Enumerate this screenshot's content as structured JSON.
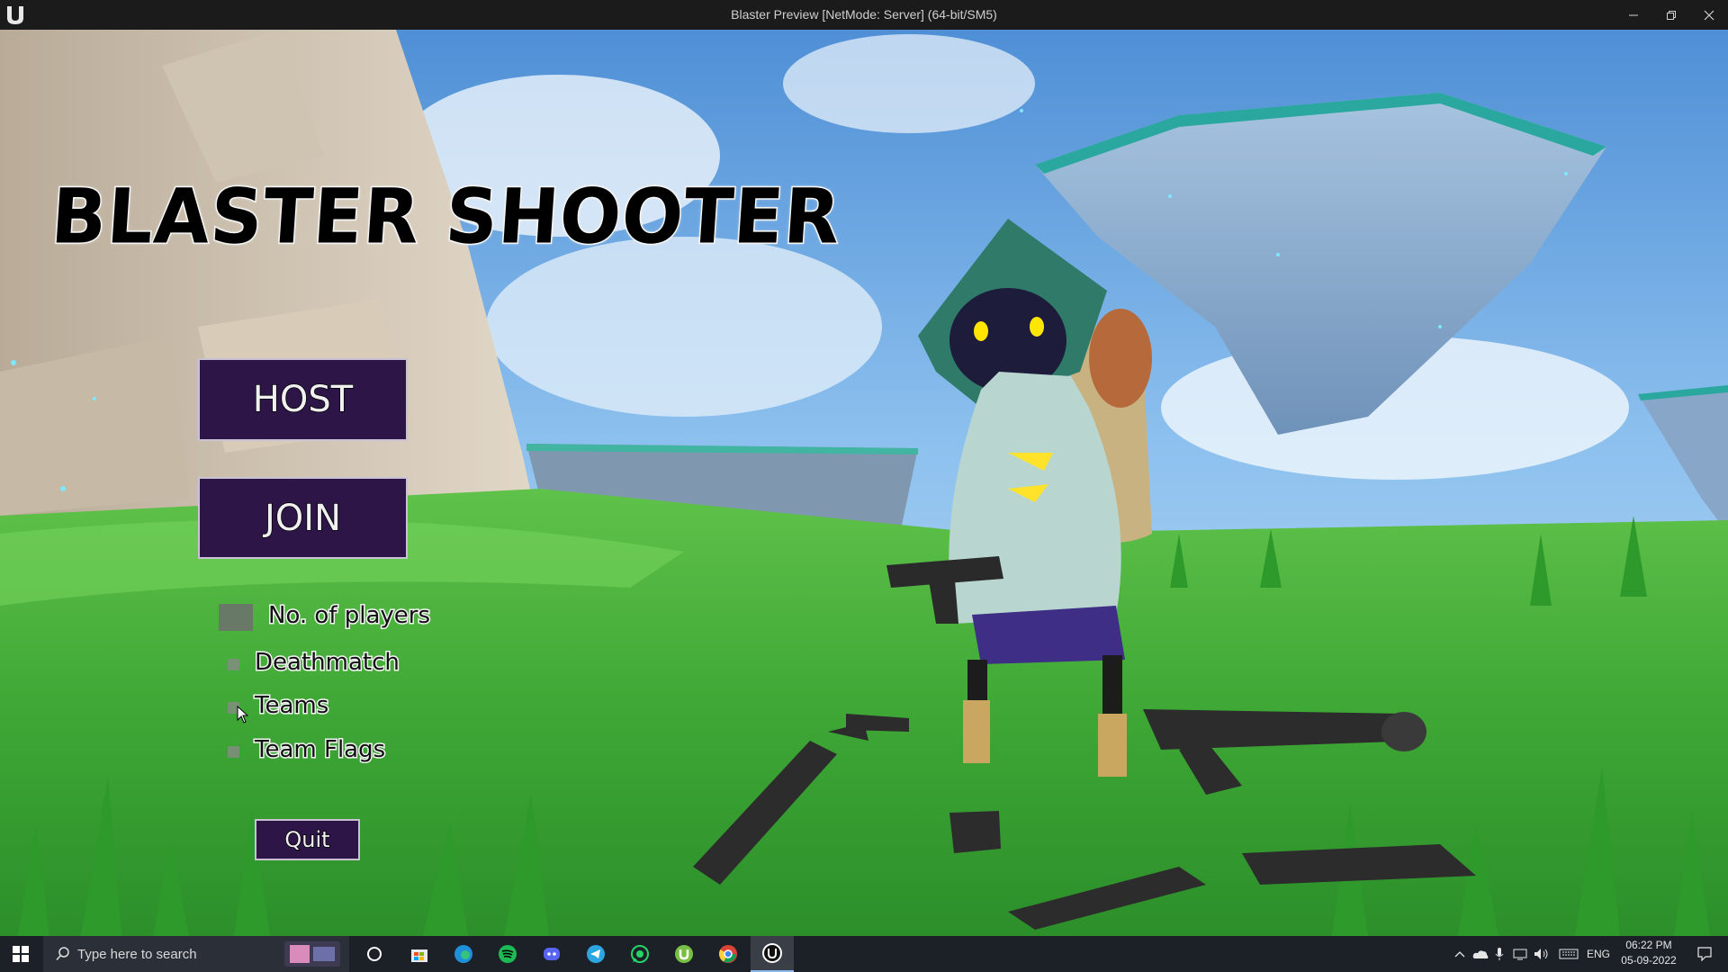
{
  "window": {
    "title": "Blaster Preview [NetMode: Server]  (64-bit/SM5)",
    "controls": [
      "minimize",
      "restore",
      "close"
    ]
  },
  "game": {
    "title": "BLASTER SHOOTER",
    "host_label": "HOST",
    "join_label": "JOIN",
    "players_label": "No. of players",
    "options": [
      {
        "label": "Deathmatch",
        "checked": false
      },
      {
        "label": "Teams",
        "checked": false
      },
      {
        "label": "Team Flags",
        "checked": false
      }
    ],
    "quit_label": "Quit"
  },
  "taskbar": {
    "search_placeholder": "Type here to search",
    "apps": [
      "windows-start-icon",
      "search-icon",
      "cortana-icon",
      "store-icon",
      "edge-icon",
      "spotify-icon",
      "discord-icon",
      "telegram-icon",
      "whatsapp-icon",
      "utorrent-icon",
      "chrome-icon",
      "unreal-engine-icon"
    ],
    "language": "ENG",
    "time": "06:22 PM",
    "date": "05-09-2022"
  },
  "colors": {
    "button_fill": "#2d1547",
    "button_border": "#c9c2d4",
    "titlebar": "#1b1b1b",
    "taskbar": "#1c2128"
  }
}
